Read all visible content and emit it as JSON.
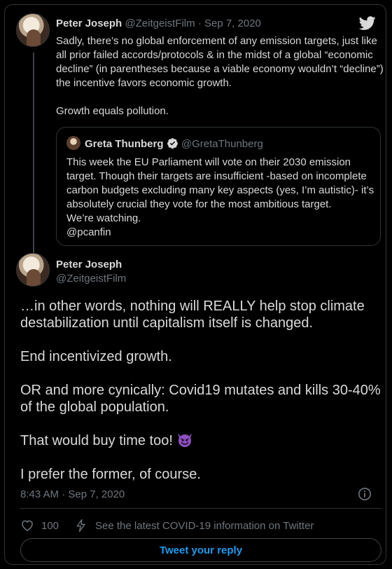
{
  "quoted_reply": {
    "author_name": "Peter Joseph",
    "author_handle": "@ZeitgeistFilm",
    "separator": "·",
    "date": "Sep 7, 2020",
    "body_lines": [
      "Sadly, there’s no global enforcement of any emission targets, just like all prior failed accords/protocols & in the midst of a global “economic decline” (in parentheses because a viable economy wouldn’t “decline”) the incentive favors economic growth.",
      "Growth equals pollution."
    ]
  },
  "embedded_quote": {
    "author_name": "Greta Thunberg",
    "author_handle": "@GretaThunberg",
    "body": "This week the EU Parliament will vote on their 2030 emission target. Though their targets are insufficient -based on incomplete carbon budgets excluding many key aspects (yes, I’m autistic)- it’s absolutely crucial they vote for the most ambitious target.",
    "body_line2": "We’re watching.",
    "body_line3": "@pcanfin"
  },
  "main_tweet": {
    "author_name": "Peter Joseph",
    "author_handle": "@ZeitgeistFilm",
    "paragraphs": [
      "…in other words, nothing will REALLY help stop climate destabilization until capitalism itself is changed.",
      "End incentivized growth.",
      "OR and more cynically: Covid19 mutates and kills 30-40% of the global population.",
      "That would buy time too!",
      "I prefer the former, of course."
    ],
    "emoji": "smiling-imp",
    "timestamp": "8:43 AM · Sep 7, 2020"
  },
  "actions": {
    "like_count": "100",
    "covid_info": "See the latest COVID-19 information on Twitter"
  },
  "reply_button_label": "Tweet your reply",
  "colors": {
    "background": "#000000",
    "text": "#d9d9d9",
    "muted": "#6e767d",
    "accent": "#1d9bf0",
    "emoji": "#8c4fbd"
  },
  "icons": [
    "twitter-bird-icon",
    "verified-badge-icon",
    "info-icon",
    "heart-icon",
    "covid-info-icon",
    "smiling-imp-emoji"
  ]
}
